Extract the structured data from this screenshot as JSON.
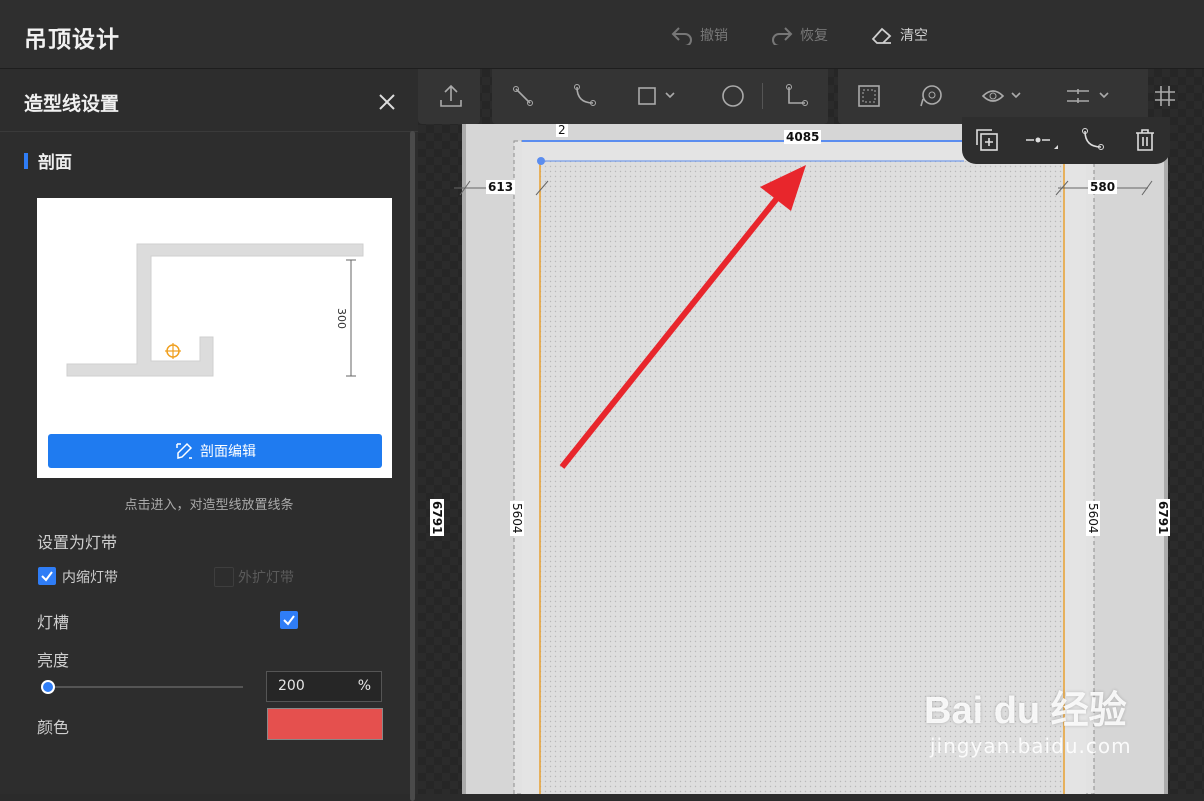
{
  "app": {
    "title": "吊顶设计"
  },
  "topbar": {
    "undo_label": "撤销",
    "redo_label": "恢复",
    "clear_label": "清空"
  },
  "panel": {
    "title": "造型线设置",
    "section_title": "剖面",
    "preview_dimension": "300",
    "edit_button_label": "剖面编辑",
    "hint": "点击进入，对造型线放置线条",
    "light_strip_heading": "设置为灯带",
    "inner_strip": {
      "label": "内缩灯带",
      "checked": true
    },
    "outer_strip": {
      "label": "外扩灯带",
      "checked": false
    },
    "light_slot": {
      "label": "灯槽",
      "checked": true
    },
    "brightness": {
      "label": "亮度",
      "value": "200",
      "unit": "%"
    },
    "color": {
      "label": "颜色",
      "value": "#e5504e"
    }
  },
  "canvas": {
    "dims": {
      "top": "4085",
      "top_small": "2",
      "left": "613",
      "right": "580",
      "outer_left": "6791",
      "outer_right": "6791",
      "inner_left": "5604",
      "inner_right": "5604"
    },
    "accent_color": "#5b8def"
  },
  "watermark": {
    "brand": "Bai du 经验",
    "url": "jingyan.baidu.com"
  }
}
